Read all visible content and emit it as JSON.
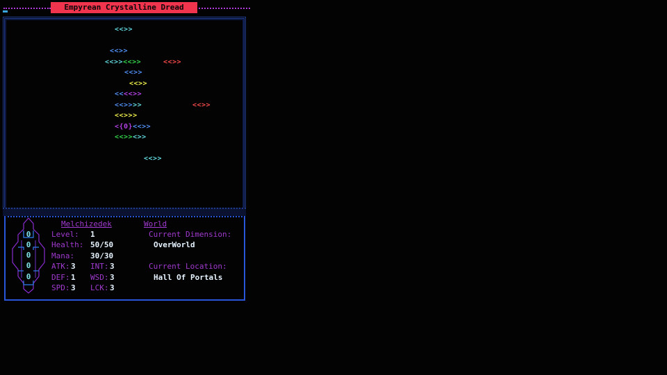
{
  "title": "Empyrean Crystalline Dread",
  "colors": {
    "teal": "#5fd3d8",
    "blue": "#4f8cf0",
    "green": "#33d04a",
    "red": "#f04848",
    "yellow": "#e8e84a",
    "magenta": "#b040e0",
    "label": "#a03ad0",
    "frame": "#2856d8"
  },
  "portal_grid": [
    {
      "id": "r1",
      "segments": [
        {
          "text": "<<>>",
          "color": "teal"
        }
      ]
    },
    {
      "id": "r2",
      "segments": [
        {
          "text": "<<>>",
          "color": "blue"
        }
      ]
    },
    {
      "id": "r3",
      "segments": [
        {
          "text": "<<>>",
          "color": "teal"
        },
        {
          "text": "<<>>",
          "color": "green"
        }
      ]
    },
    {
      "id": "r3b",
      "segments": [
        {
          "text": "<<>>",
          "color": "red"
        }
      ]
    },
    {
      "id": "r4",
      "segments": [
        {
          "text": "<<>>",
          "color": "blue"
        }
      ]
    },
    {
      "id": "r5",
      "segments": [
        {
          "text": "<<>>",
          "color": "yellow"
        }
      ]
    },
    {
      "id": "r6",
      "segments": [
        {
          "text": "<<",
          "color": "blue"
        },
        {
          "text": "<<>>",
          "color": "magenta"
        }
      ]
    },
    {
      "id": "r7",
      "segments": [
        {
          "text": "<<>>",
          "color": "blue"
        },
        {
          "text": ">>",
          "color": "teal"
        }
      ]
    },
    {
      "id": "r7b",
      "segments": [
        {
          "text": "<<>>",
          "color": "red"
        }
      ]
    },
    {
      "id": "r8",
      "segments": [
        {
          "text": "<<>>",
          "color": "yellow"
        },
        {
          "text": ">",
          "color": "yellow"
        }
      ]
    },
    {
      "id": "r9",
      "segments": [
        {
          "text": "<{0}",
          "color": "magenta"
        },
        {
          "text": "<<>>",
          "color": "blue"
        }
      ]
    },
    {
      "id": "r10",
      "segments": [
        {
          "text": "<<>>",
          "color": "green"
        },
        {
          "text": "<>>",
          "color": "teal"
        }
      ]
    },
    {
      "id": "r11",
      "segments": [
        {
          "text": "<<>>",
          "color": "teal"
        }
      ]
    }
  ],
  "character": {
    "name": "Melchizedek",
    "emblem_glyph": "0",
    "level_label": "Level:",
    "level": "1",
    "health_label": "Health:",
    "health": "50/50",
    "mana_label": "Mana:",
    "mana": "30/30",
    "atk_label": "ATK:",
    "atk": "3",
    "int_label": "INT:",
    "int": "3",
    "def_label": "DEF:",
    "def": "1",
    "wsd_label": "WSD:",
    "wsd": "3",
    "spd_label": "SPD:",
    "spd": "3",
    "lck_label": "LCK:",
    "lck": "3"
  },
  "world": {
    "heading": "World",
    "dimension_label": "Current Dimension:",
    "dimension": "OverWorld",
    "location_label": "Current Location:",
    "location": "Hall Of Portals"
  }
}
